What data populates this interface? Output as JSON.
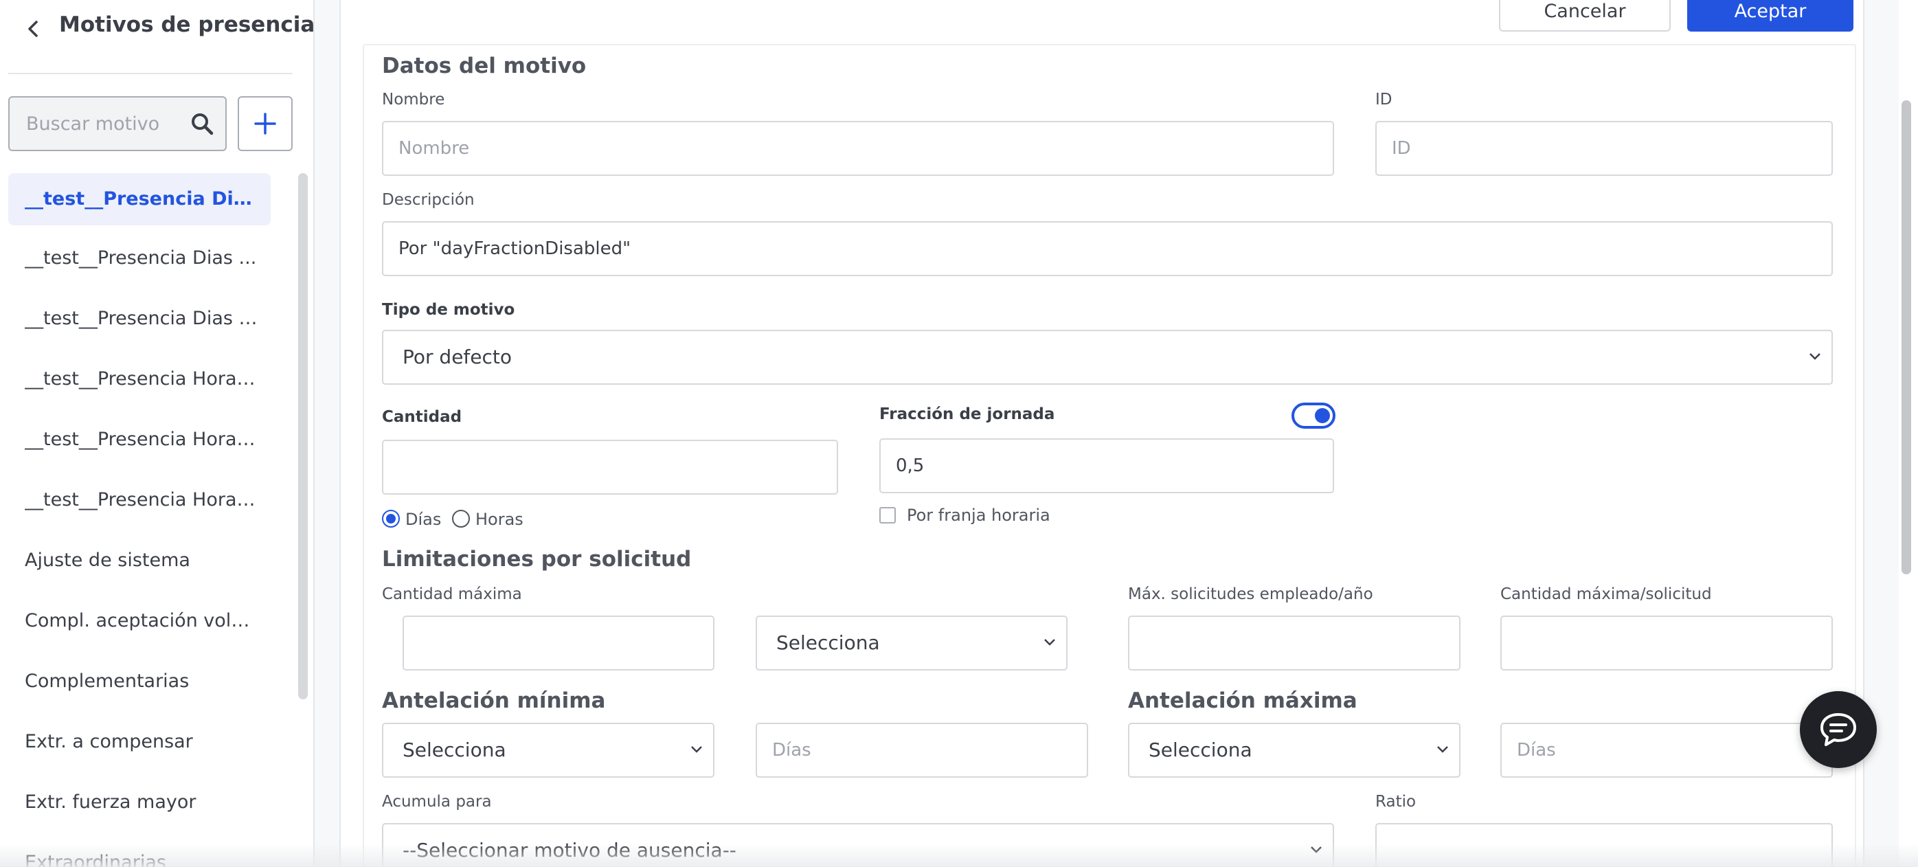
{
  "sidebar": {
    "title": "Motivos de presencia",
    "search": {
      "placeholder": "Buscar motivo",
      "value": ""
    },
    "items": [
      {
        "label": "__test__Presencia Dias F...",
        "active": true
      },
      {
        "label": "__test__Presencia Dias ..."
      },
      {
        "label": "__test__Presencia Dias R..."
      },
      {
        "label": "__test__Presencia Horas..."
      },
      {
        "label": "__test__Presencia Horas..."
      },
      {
        "label": "__test__Presencia Horas..."
      },
      {
        "label": "Ajuste de sistema"
      },
      {
        "label": "Compl. aceptación volun..."
      },
      {
        "label": "Complementarias"
      },
      {
        "label": "Extr. a compensar"
      },
      {
        "label": "Extr. fuerza mayor"
      },
      {
        "label": "Extraordinarias"
      }
    ]
  },
  "toolbar": {
    "cancel_label": "Cancelar",
    "accept_label": "Aceptar"
  },
  "form": {
    "section_title": "Datos del motivo",
    "nombre": {
      "label": "Nombre",
      "placeholder": "Nombre",
      "value": ""
    },
    "id": {
      "label": "ID",
      "placeholder": "ID",
      "value": ""
    },
    "descripcion": {
      "label": "Descripción",
      "value": "Por \"dayFractionDisabled\""
    },
    "tipo": {
      "label": "Tipo de motivo",
      "value": "Por defecto"
    },
    "cantidad": {
      "label": "Cantidad",
      "value": "",
      "unit_days": "Días",
      "unit_hours": "Horas",
      "selected_unit": "Días"
    },
    "fraccion": {
      "label": "Fracción de jornada",
      "value": "0,5",
      "toggle_on": true,
      "franja_label": "Por franja horaria",
      "franja_checked": false
    },
    "limitaciones": {
      "title": "Limitaciones por solicitud",
      "cantidad_maxima_label": "Cantidad máxima",
      "cantidad_maxima_value": "",
      "unidad_select": "Selecciona",
      "max_solicitudes_label": "Máx. solicitudes empleado/año",
      "max_solicitudes_value": "",
      "cantidad_max_solicitud_label": "Cantidad máxima/solicitud",
      "cantidad_max_solicitud_value": ""
    },
    "antelacion_minima": {
      "title": "Antelación mínima",
      "select": "Selecciona",
      "days_placeholder": "Días"
    },
    "antelacion_maxima": {
      "title": "Antelación máxima",
      "select": "Selecciona",
      "days_placeholder": "Días"
    },
    "acumula": {
      "label": "Acumula para",
      "value": "--Seleccionar motivo de ausencia--"
    },
    "ratio": {
      "label": "Ratio",
      "value": ""
    }
  },
  "colors": {
    "accent": "#2354e0",
    "text": "#3b3f47",
    "border": "#d6d8dc"
  },
  "icons": {
    "back": "chevron-left-icon",
    "search": "search-icon",
    "add": "plus-icon",
    "chat": "chat-bubble-icon"
  }
}
